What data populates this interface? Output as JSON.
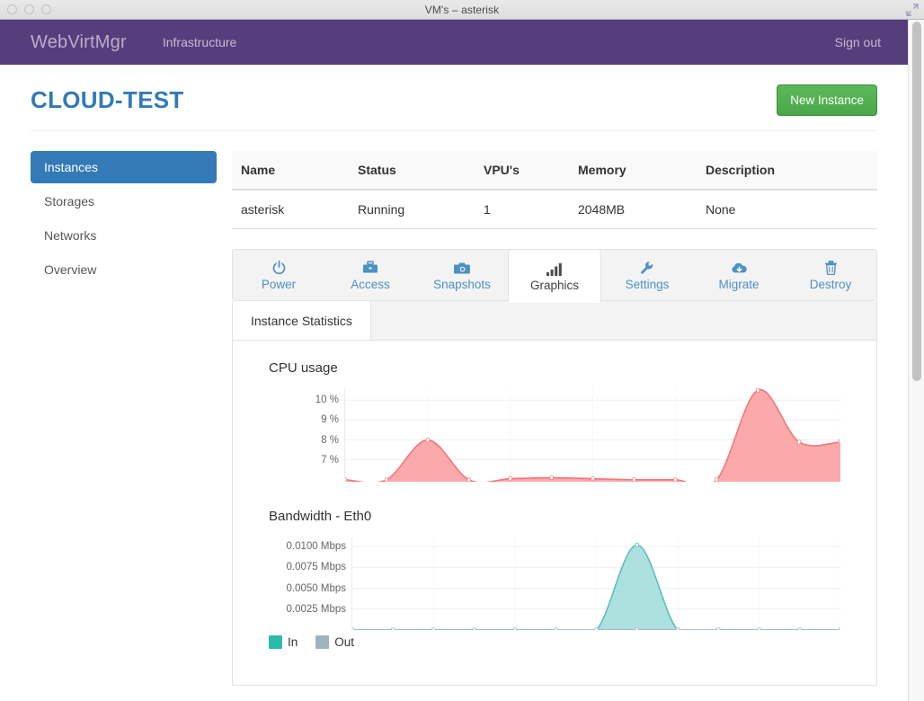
{
  "window": {
    "title": "VM's – asterisk",
    "controls": [
      "close-dot",
      "minimize-dot",
      "zoom-dot"
    ],
    "fullscreen_icon": "fullscreen-icon"
  },
  "navbar": {
    "brand": "WebVirtMgr",
    "links": [
      {
        "label": "Infrastructure",
        "name": "nav-link-infrastructure"
      }
    ],
    "right_link": "Sign out",
    "background": "#563d7c"
  },
  "header": {
    "title": "CLOUD-TEST",
    "title_color": "#337ab7",
    "new_instance_label": "New Instance",
    "new_instance_color": "#5cb85c"
  },
  "sidebar": {
    "items": [
      {
        "label": "Instances",
        "active": true
      },
      {
        "label": "Storages",
        "active": false
      },
      {
        "label": "Networks",
        "active": false
      },
      {
        "label": "Overview",
        "active": false
      }
    ],
    "active_color": "#337ab7"
  },
  "instance_table": {
    "columns": [
      "Name",
      "Status",
      "VPU's",
      "Memory",
      "Description"
    ],
    "rows": [
      {
        "name": "asterisk",
        "status": "Running",
        "status_color": "#5cb85c",
        "vpus": "1",
        "memory": "2048MB",
        "description": "None"
      }
    ]
  },
  "instance_tabs": {
    "active": "Graphics",
    "items": [
      {
        "label": "Power",
        "icon": "power-icon"
      },
      {
        "label": "Access",
        "icon": "briefcase-icon"
      },
      {
        "label": "Snapshots",
        "icon": "camera-icon"
      },
      {
        "label": "Graphics",
        "icon": "bar-chart-icon"
      },
      {
        "label": "Settings",
        "icon": "wrench-icon"
      },
      {
        "label": "Migrate",
        "icon": "cloud-download-icon"
      },
      {
        "label": "Destroy",
        "icon": "trash-icon"
      }
    ],
    "link_color": "#4c91c4"
  },
  "stats_panel": {
    "tab_label": "Instance Statistics"
  },
  "chart_data": [
    {
      "type": "area",
      "name": "cpu-usage-chart",
      "title": "CPU usage",
      "xlabel": "",
      "ylabel": "",
      "ytick_labels": [
        "10 %",
        "9 %",
        "8 %",
        "7 %"
      ],
      "ytick_values": [
        10,
        9,
        8,
        7
      ],
      "ylim": [
        5.9,
        10.6
      ],
      "grid": true,
      "legend": "none",
      "series": [
        {
          "name": "CPU usage",
          "color": "#f2777a",
          "fill": "#fb9a9c",
          "x": [
            0,
            1,
            2,
            3,
            4,
            5,
            6,
            7,
            8,
            9,
            10,
            11,
            12
          ],
          "values": [
            6.0,
            6.0,
            8.0,
            6.0,
            6.05,
            6.1,
            6.05,
            6.0,
            6.0,
            6.0,
            10.5,
            7.9,
            7.9
          ]
        }
      ]
    },
    {
      "type": "area",
      "name": "bandwidth-eth0-chart",
      "title": "Bandwidth - Eth0",
      "xlabel": "",
      "ylabel": "",
      "ytick_labels": [
        "0.0100 Mbps",
        "0.0075 Mbps",
        "0.0050 Mbps",
        "0.0025 Mbps"
      ],
      "ytick_values": [
        0.01,
        0.0075,
        0.005,
        0.0025
      ],
      "ylim": [
        0,
        0.0112
      ],
      "grid": true,
      "legend": "bottom-left",
      "series": [
        {
          "name": "In",
          "color": "#5bc0be",
          "fill": "#9fdcd9",
          "x": [
            0,
            1,
            2,
            3,
            4,
            5,
            6,
            7,
            8,
            9,
            10,
            11,
            12
          ],
          "values": [
            0,
            0,
            0,
            0,
            0,
            0,
            0,
            0.0102,
            0,
            0,
            0,
            0,
            0
          ]
        },
        {
          "name": "Out",
          "color": "#96aec0",
          "fill": "#b9c9d4",
          "x": [
            0,
            1,
            2,
            3,
            4,
            5,
            6,
            7,
            8,
            9,
            10,
            11,
            12
          ],
          "values": [
            0,
            0,
            0,
            0,
            0,
            0,
            0,
            0,
            0,
            0,
            0,
            0,
            0
          ]
        }
      ],
      "legend_entries": [
        {
          "label": "In",
          "color": "#2bbbad"
        },
        {
          "label": "Out",
          "color": "#9db4c0"
        }
      ]
    }
  ]
}
